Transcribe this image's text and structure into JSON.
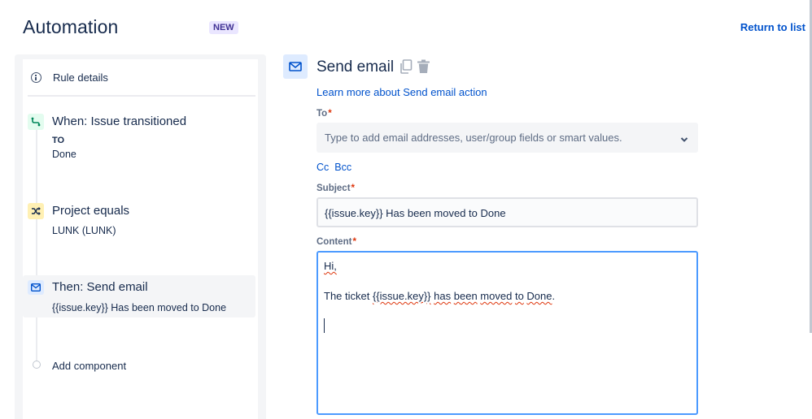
{
  "header": {
    "title": "Automation",
    "badge": "NEW",
    "return_link": "Return to list"
  },
  "sidebar": {
    "rule_details": "Rule details",
    "steps": [
      {
        "title": "When: Issue transitioned",
        "sub1": "TO",
        "sub2": "Done",
        "icon": "transition-icon"
      },
      {
        "title": "Project equals",
        "sub1": "LUNK (LUNK)",
        "icon": "shuffle-icon"
      },
      {
        "title": "Then: Send email",
        "sub1": "{{issue.key}} Has been moved to Done",
        "icon": "mail-icon"
      }
    ],
    "add_component": "Add component"
  },
  "panel": {
    "title": "Send email",
    "learn_more": "Learn more about Send email action",
    "to_label": "To",
    "to_placeholder": "Type to add email addresses, user/group fields or smart values.",
    "cc": "Cc",
    "bcc": "Bcc",
    "subject_label": "Subject",
    "subject_value": "{{issue.key}} Has been moved to Done",
    "content_label": "Content",
    "content_line1": "Hi,",
    "content_line2_a": "The ticket ",
    "content_line2_b": "{{issue.key}}",
    "content_line2_c": " ",
    "content_line2_d": "has",
    "content_line2_e": " ",
    "content_line2_f": "been",
    "content_line2_g": " ",
    "content_line2_h": "moved",
    "content_line2_i": " ",
    "content_line2_j": "to",
    "content_line2_k": " ",
    "content_line2_l": "Done",
    "content_line2_m": ".",
    "required_marker": "*"
  },
  "colors": {
    "link": "#0052cc",
    "focus_border": "#4c9aff",
    "required": "#de350b",
    "trigger_green": "#00875a",
    "condition_yellow": "#fff0b3",
    "action_blue": "#deebff"
  }
}
